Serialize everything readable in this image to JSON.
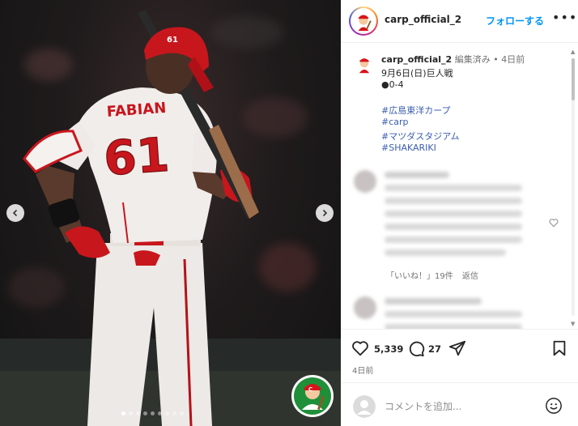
{
  "header": {
    "username": "carp_official_2",
    "follow_label": "フォローする",
    "more_label": "•••"
  },
  "caption": {
    "username": "carp_official_2",
    "edited": "編集済み",
    "separator": "•",
    "time": "4日前",
    "line1": "9月6日(日)巨人戦",
    "line2": "●0-4",
    "hashtags": [
      "#広島東洋カープ",
      "#carp",
      "#マツダスタジアム",
      "#SHAKARIKI"
    ]
  },
  "comment": {
    "likes_label": "「いいね！」19件",
    "reply_label": "返信"
  },
  "photo": {
    "jersey_name": "FABIAN",
    "jersey_number": "61",
    "helmet_number": "61",
    "carousel_dots": 9,
    "active_dot": 0
  },
  "actions": {
    "like_count": "5,339",
    "comment_count": "27",
    "date": "4日前"
  },
  "composer": {
    "placeholder": "コメントを追加..."
  },
  "colors": {
    "accent": "#0095f6",
    "hashtag": "#3b5eb0",
    "carp_red": "#d7141a"
  },
  "icons": {
    "prev": "chevron-left-icon",
    "next": "chevron-right-icon",
    "like": "heart-icon",
    "comment": "comment-bubble-icon",
    "share": "paper-plane-icon",
    "save": "bookmark-icon",
    "emoji": "smiley-icon",
    "more": "more-dots-icon"
  }
}
